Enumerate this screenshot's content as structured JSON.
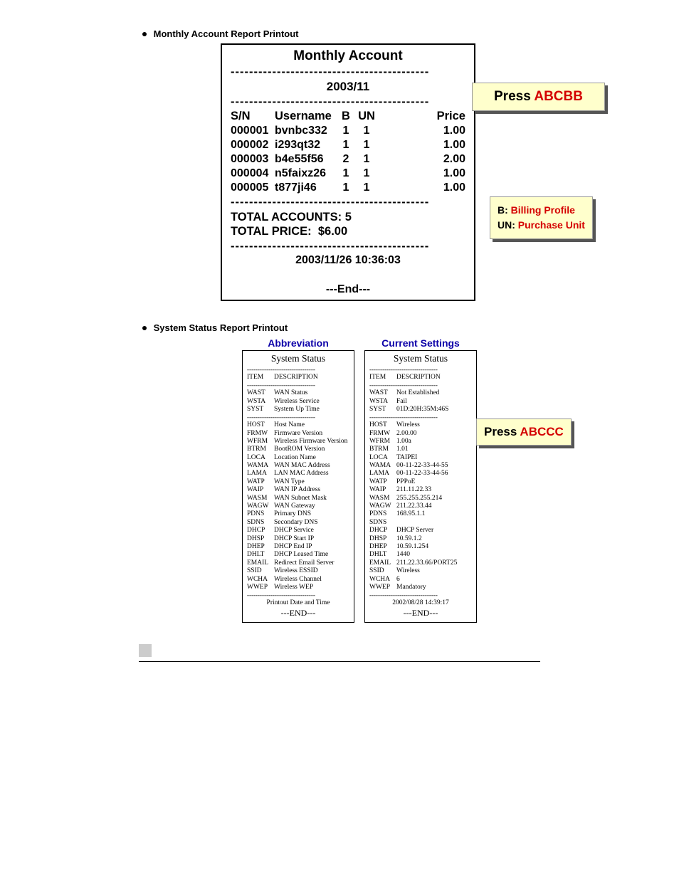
{
  "headings": {
    "monthly": "Monthly Account Report Printout",
    "system": "System Status Report Printout"
  },
  "monthly": {
    "title": "Monthly Account",
    "sep": "-------------------------------------------",
    "period": "2003/11",
    "columns": {
      "sn": "S/N",
      "user": "Username",
      "b": "B",
      "un": "UN",
      "price": "Price"
    },
    "rows": [
      {
        "sn": "000001",
        "user": "bvnbc332",
        "b": "1",
        "un": "1",
        "price": "1.00"
      },
      {
        "sn": "000002",
        "user": "i293qt32",
        "b": "1",
        "un": "1",
        "price": "1.00"
      },
      {
        "sn": "000003",
        "user": "b4e55f56",
        "b": "2",
        "un": "1",
        "price": "2.00"
      },
      {
        "sn": "000004",
        "user": "n5faixz26",
        "b": "1",
        "un": "1",
        "price": "1.00"
      },
      {
        "sn": "000005",
        "user": "t877ji46",
        "b": "1",
        "un": "1",
        "price": "1.00"
      }
    ],
    "total_accounts_label": "TOTAL ACCOUNTS:",
    "total_accounts_value": "5",
    "total_price_label": "TOTAL PRICE:",
    "total_price_value": "$6.00",
    "timestamp": "2003/11/26 10:36:03",
    "end": "---End---"
  },
  "callouts": {
    "monthly_press_black": "Press ",
    "monthly_press_red": "ABCBB",
    "legend_b_black": "B: ",
    "legend_b_red": "Billing Profile",
    "legend_un_black": "UN: ",
    "legend_un_red": "Purchase Unit",
    "system_press_black": "Press ",
    "system_press_red": "ABCCC"
  },
  "system": {
    "col1_title": "Abbreviation",
    "col2_title": "Current Settings",
    "box_title": "System Status",
    "hdr_item": "ITEM",
    "hdr_desc": "DESCRIPTION",
    "hr": "--------------------------------",
    "abbrev_group1": [
      {
        "k": "WAST",
        "v": "WAN Status"
      },
      {
        "k": "WSTA",
        "v": "Wireless Service"
      },
      {
        "k": "SYST",
        "v": "System Up Time"
      }
    ],
    "abbrev_group2": [
      {
        "k": "HOST",
        "v": "Host Name"
      },
      {
        "k": "FRMW",
        "v": "Firmware Version"
      },
      {
        "k": "WFRM",
        "v": "Wireless Firmware Version"
      },
      {
        "k": "BTRM",
        "v": "BootROM Version"
      },
      {
        "k": "LOCA",
        "v": "Location Name"
      },
      {
        "k": "WAMA",
        "v": "WAN MAC Address"
      },
      {
        "k": "LAMA",
        "v": "LAN MAC Address"
      },
      {
        "k": "WATP",
        "v": "WAN Type"
      },
      {
        "k": "WAIP",
        "v": "WAN IP Address"
      },
      {
        "k": "WASM",
        "v": "WAN Subnet Mask"
      },
      {
        "k": "WAGW",
        "v": "WAN Gateway"
      },
      {
        "k": "PDNS",
        "v": "Primary DNS"
      },
      {
        "k": "SDNS",
        "v": "Secondary DNS"
      },
      {
        "k": "DHCP",
        "v": "DHCP Service"
      },
      {
        "k": "DHSP",
        "v": "DHCP Start IP"
      },
      {
        "k": "DHEP",
        "v": "DHCP End IP"
      },
      {
        "k": "DHLT",
        "v": "DHCP Leased Time"
      },
      {
        "k": "EMAIL",
        "v": "Redirect Email Server"
      },
      {
        "k": "SSID",
        "v": "Wireless ESSID"
      },
      {
        "k": "WCHA",
        "v": "Wireless Channel"
      },
      {
        "k": "WWEP",
        "v": "Wireless WEP"
      }
    ],
    "abbrev_footer": "Printout Date and Time",
    "end": "---END---",
    "current_group1": [
      {
        "k": "WAST",
        "v": "Not Established"
      },
      {
        "k": "WSTA",
        "v": "Fail"
      },
      {
        "k": "SYST",
        "v": "01D:20H:35M:46S"
      }
    ],
    "current_group2": [
      {
        "k": "HOST",
        "v": "Wireless"
      },
      {
        "k": "FRMW",
        "v": "2.00.00"
      },
      {
        "k": "WFRM",
        "v": "1.00a"
      },
      {
        "k": "BTRM",
        "v": "1.01"
      },
      {
        "k": "LOCA",
        "v": "TAIPEI"
      },
      {
        "k": "WAMA",
        "v": "00-11-22-33-44-55"
      },
      {
        "k": "LAMA",
        "v": "00-11-22-33-44-56"
      },
      {
        "k": "WATP",
        "v": "PPPoE"
      },
      {
        "k": "WAIP",
        "v": "211.11.22.33"
      },
      {
        "k": "WASM",
        "v": "255.255.255.214"
      },
      {
        "k": "WAGW",
        "v": "211.22.33.44"
      },
      {
        "k": "PDNS",
        "v": "168.95.1.1"
      },
      {
        "k": "SDNS",
        "v": ""
      },
      {
        "k": "DHCP",
        "v": "DHCP Server"
      },
      {
        "k": "DHSP",
        "v": "10.59.1.2"
      },
      {
        "k": "DHEP",
        "v": "10.59.1.254"
      },
      {
        "k": "DHLT",
        "v": "1440"
      },
      {
        "k": "EMAIL",
        "v": "211.22.33.66/PORT25"
      },
      {
        "k": "SSID",
        "v": "Wireless"
      },
      {
        "k": "WCHA",
        "v": "6"
      },
      {
        "k": "WWEP",
        "v": "Mandatory"
      }
    ],
    "current_footer": "2002/08/28 14:39:17"
  }
}
